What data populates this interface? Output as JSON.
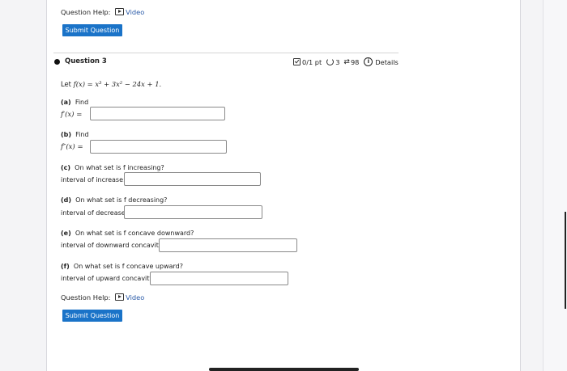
{
  "help_top": {
    "label": "Question Help:",
    "video": "Video"
  },
  "submit_top": "Submit Question",
  "question": {
    "title": "Question 3",
    "points": "0/1 pt",
    "retries": "3",
    "submissions": "98",
    "details": "Details",
    "prompt_prefix": "Let ",
    "function_expr": "f(x) = x³ + 3x² − 24x + 1.",
    "parts": [
      {
        "tag": "(a)",
        "question": "Find",
        "field_label": "f′(x) =",
        "value": ""
      },
      {
        "tag": "(b)",
        "question": "Find",
        "field_label": "f″(x) =",
        "value": ""
      },
      {
        "tag": "(c)",
        "question": "On what set is f increasing?",
        "field_label": "interval of increase:",
        "value": ""
      },
      {
        "tag": "(d)",
        "question": "On what set is f decreasing?",
        "field_label": "interval of decrease:",
        "value": ""
      },
      {
        "tag": "(e)",
        "question": "On what set is f concave downward?",
        "field_label": "interval of downward concavity:",
        "value": ""
      },
      {
        "tag": "(f)",
        "question": "On what set is f concave upward?",
        "field_label": "interval of upward concavity:",
        "value": ""
      }
    ]
  },
  "help_bottom": {
    "label": "Question Help:",
    "video": "Video"
  },
  "submit_bottom": "Submit Question"
}
